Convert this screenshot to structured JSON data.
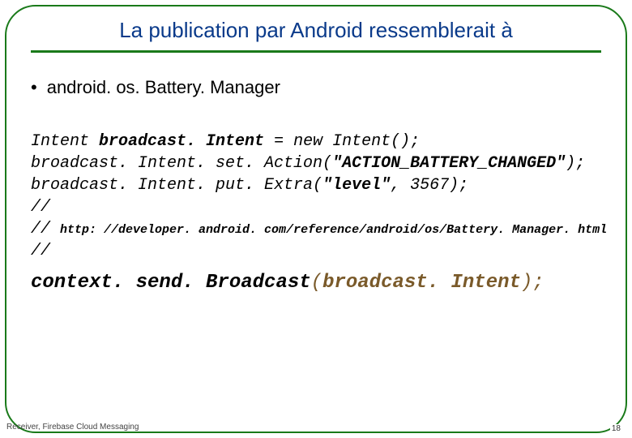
{
  "title": "La publication par Android ressemblerait à",
  "bullet": {
    "marker": "•",
    "text": "android. os. Battery. Manager"
  },
  "code": {
    "l1a": "Intent ",
    "l1b": "broadcast. Intent",
    "l1c": " = new Intent();",
    "l2a": "broadcast. Intent. set. Action(",
    "l2b": "\"ACTION_BATTERY_CHANGED\"",
    "l2c": ");",
    "l3a": "broadcast. Intent. put. Extra(",
    "l3b": "\"level\"",
    "l3c": ", 3567);",
    "l4": "//",
    "l5a": "// ",
    "l5b": "http: //developer. android. com/reference/android/os/Battery. Manager. html",
    "l6": "//"
  },
  "bigcode": {
    "a": "context. send. Broadcast",
    "b": "(",
    "c": "broadcast. Intent",
    "d": ");"
  },
  "footer": "Receiver, Firebase Cloud Messaging",
  "pagenum": "18"
}
